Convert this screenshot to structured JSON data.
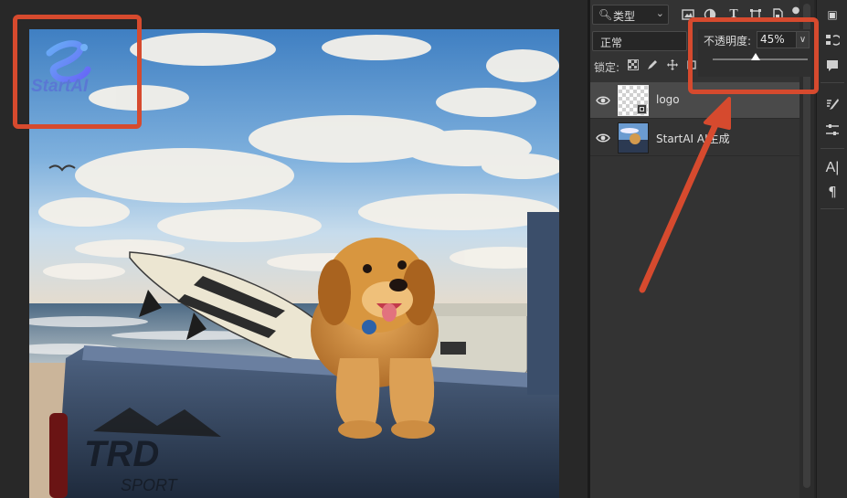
{
  "canvas": {
    "watermark_text": "StartAI"
  },
  "layers_panel": {
    "filter": {
      "kind_label": "类型"
    },
    "blend_mode": "正常",
    "lock_label": "锁定:",
    "opacity": {
      "label": "不透明度:",
      "value": "45%",
      "level_percent": 45
    },
    "layers": [
      {
        "name": "logo",
        "selected": true,
        "visible": true,
        "thumbnail": "transparent-smart-object"
      },
      {
        "name": "StartAI AI生成",
        "selected": false,
        "visible": true,
        "thumbnail": "photo"
      }
    ]
  },
  "right_tools": [
    "plugin-icon",
    "history-icon",
    "comment-icon",
    "brush-settings-icon",
    "adjustments-icon",
    "character-icon",
    "paragraph-icon"
  ],
  "colors": {
    "annotation": "#d64a2e",
    "panel_bg": "#333333",
    "selected_layer": "#4a4a4a"
  }
}
